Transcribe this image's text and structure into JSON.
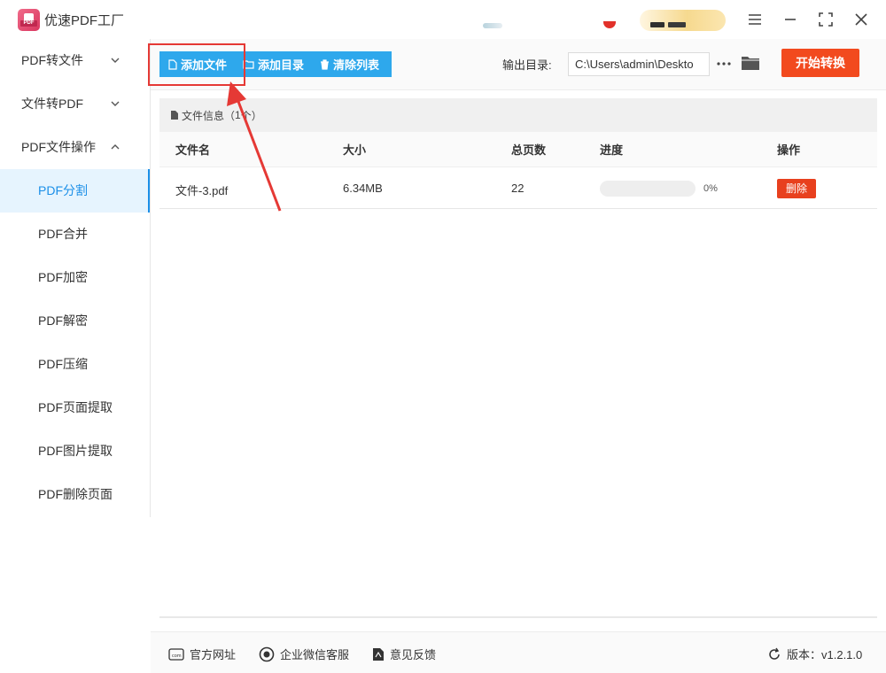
{
  "app": {
    "title": "优速PDF工厂",
    "logo_text": "PDF"
  },
  "sidebar": {
    "groups": [
      {
        "label": "PDF转文件",
        "expanded": false
      },
      {
        "label": "文件转PDF",
        "expanded": false
      },
      {
        "label": "PDF文件操作",
        "expanded": true
      }
    ],
    "items": [
      {
        "label": "PDF分割",
        "active": true
      },
      {
        "label": "PDF合并"
      },
      {
        "label": "PDF加密"
      },
      {
        "label": "PDF解密"
      },
      {
        "label": "PDF压缩"
      },
      {
        "label": "PDF页面提取"
      },
      {
        "label": "PDF图片提取"
      },
      {
        "label": "PDF删除页面"
      }
    ]
  },
  "toolbar": {
    "add_file": "添加文件",
    "add_folder": "添加目录",
    "clear_list": "清除列表",
    "output_label": "输出目录:",
    "output_path": "C:\\Users\\admin\\Deskto",
    "start_button": "开始转换"
  },
  "file_info": {
    "label": "文件信息（",
    "count": "1",
    "suffix": "个）"
  },
  "table": {
    "headers": [
      "文件名",
      "大小",
      "总页数",
      "进度",
      "操作"
    ],
    "rows": [
      {
        "name": "文件-3.pdf",
        "size": "6.34MB",
        "pages": "22",
        "progress_text": "0%",
        "progress": 0,
        "action": "删除"
      }
    ]
  },
  "footer": {
    "website": "官方网址",
    "wechat_service": "企业微信客服",
    "feedback": "意见反馈",
    "version": "版本：v1.2.1.0"
  },
  "colors": {
    "accent_blue": "#2ea8ec",
    "active_blue": "#1b8fe8",
    "start_orange": "#f24a1e",
    "delete_red": "#e8401e",
    "annotation_red": "#e53935"
  }
}
